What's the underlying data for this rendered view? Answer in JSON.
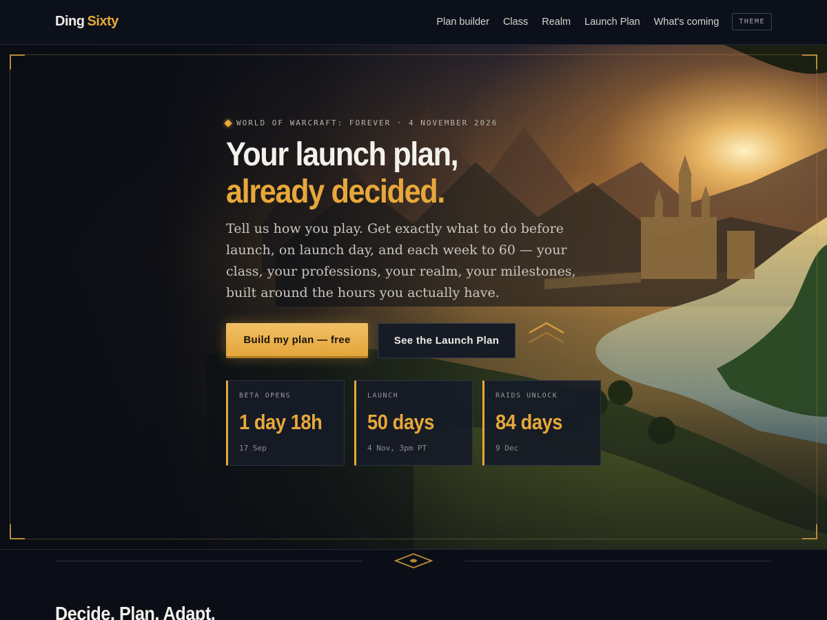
{
  "brand": {
    "part1": "Ding",
    "part2": "Sixty"
  },
  "nav": {
    "items": [
      {
        "label": "Plan builder"
      },
      {
        "label": "Class"
      },
      {
        "label": "Realm"
      },
      {
        "label": "Launch Plan"
      },
      {
        "label": "What's coming"
      }
    ],
    "theme_label": "THEME"
  },
  "hero": {
    "eyebrow": "WORLD OF WARCRAFT: FOREVER · 4 NOVEMBER 2026",
    "headline_line1": "Your launch plan,",
    "headline_line2": "already decided.",
    "lede": "Tell us how you play. Get exactly what to do before launch, on launch day, and each week to 60 — your class, your professions, your realm, your milestones, built around the hours you actually have.",
    "primary_cta": "Build my plan — free",
    "secondary_cta": "See the Launch Plan",
    "stats": [
      {
        "label": "BETA OPENS",
        "value": "1 day 18h",
        "sub": "17 Sep"
      },
      {
        "label": "LAUNCH",
        "value": "50 days",
        "sub": "4 Nov, 3pm PT"
      },
      {
        "label": "RAIDS UNLOCK",
        "value": "84 days",
        "sub": "9 Dec"
      }
    ]
  },
  "section": {
    "title": "Decide. Plan. Adapt."
  },
  "colors": {
    "accent": "#e7a83a",
    "background": "#0b0e16",
    "panel": "#161b26"
  }
}
